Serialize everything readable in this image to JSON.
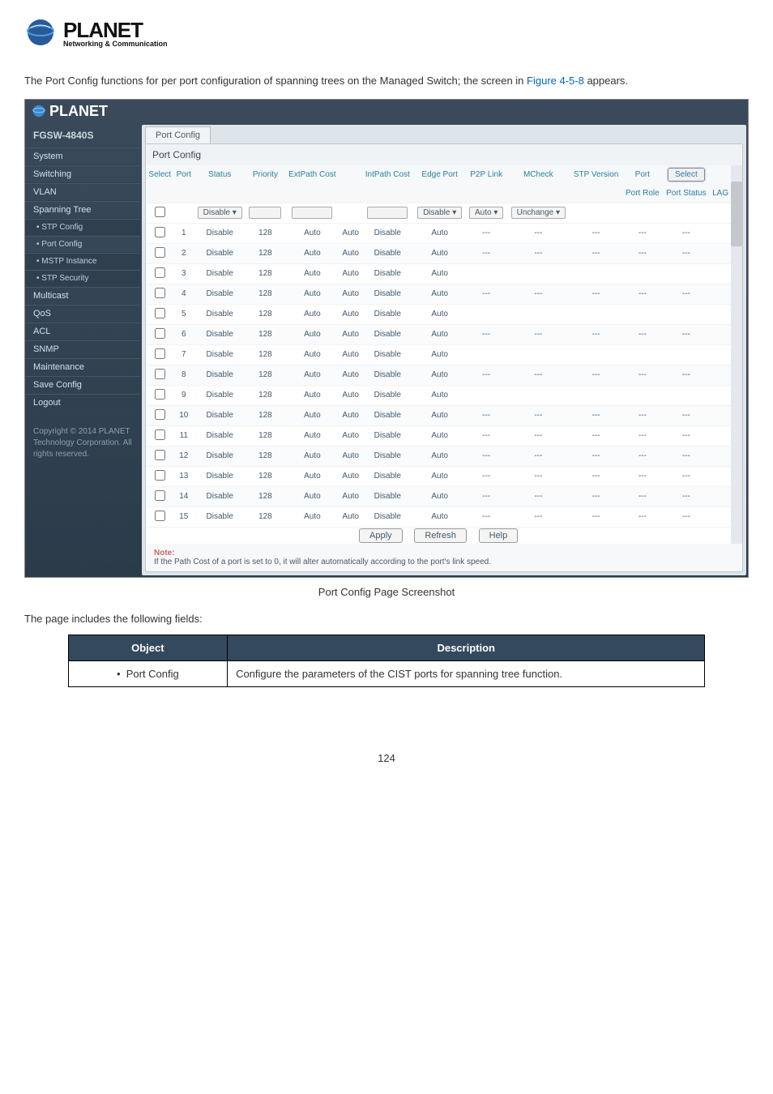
{
  "logo": {
    "brand": "PLANET",
    "tagline": "Networking & Communication"
  },
  "intro": {
    "text_before": "The Port Config functions for per port configuration of spanning trees on the Managed Switch; the screen in ",
    "figure_link": "Figure 4-5-8",
    "text_after": " appears."
  },
  "screenshot": {
    "brand": "PLANET",
    "model": "FGSW-4840S",
    "sidebar": {
      "items": [
        {
          "label": "System"
        },
        {
          "label": "Switching"
        },
        {
          "label": "VLAN"
        },
        {
          "label": "Spanning Tree"
        },
        {
          "label": "• STP Config",
          "sub": true
        },
        {
          "label": "• Port Config",
          "sub": true,
          "active": true
        },
        {
          "label": "• MSTP Instance",
          "sub": true
        },
        {
          "label": "• STP Security",
          "sub": true
        },
        {
          "label": "Multicast"
        },
        {
          "label": "QoS"
        },
        {
          "label": "ACL"
        },
        {
          "label": "SNMP"
        },
        {
          "label": "Maintenance"
        },
        {
          "label": "Save Config"
        },
        {
          "label": "Logout"
        }
      ],
      "copyright": "Copyright © 2014 PLANET Technology Corporation. All rights reserved."
    },
    "tab": "Port Config",
    "panel_title": "Port Config",
    "columns": {
      "select": "Select",
      "port": "Port",
      "status": "Status",
      "priority": "Priority",
      "ext": "ExtPath Cost",
      "intauto": "",
      "intcost": "IntPath Cost",
      "edge": "Edge Port",
      "p2p": "P2P Link",
      "mcheck": "MCheck",
      "stpv": "STP Version",
      "role": "Port Role",
      "pstatus": "Port Status",
      "lag": "LAG",
      "portlabel": "Port",
      "selectbtn": "Select"
    },
    "filter_row": {
      "status": "Disable ▾",
      "edge": "Disable ▾",
      "p2p": "Auto    ▾",
      "mcheck": "Unchange ▾"
    },
    "rows": [
      {
        "port": "1",
        "status": "Disable",
        "priority": "128",
        "ext": "Auto",
        "intauto": "Auto",
        "intcost": "Disable",
        "edge": "Auto",
        "p2p": "---",
        "mcheck": "---",
        "stpv": "---",
        "role": "---",
        "pstatus": "---"
      },
      {
        "port": "2",
        "status": "Disable",
        "priority": "128",
        "ext": "Auto",
        "intauto": "Auto",
        "intcost": "Disable",
        "edge": "Auto",
        "p2p": "---",
        "mcheck": "---",
        "stpv": "---",
        "role": "---",
        "pstatus": "---"
      },
      {
        "port": "3",
        "status": "Disable",
        "priority": "128",
        "ext": "Auto",
        "intauto": "Auto",
        "intcost": "Disable",
        "edge": "Auto",
        "p2p": "",
        "mcheck": "",
        "stpv": "",
        "role": "",
        "pstatus": ""
      },
      {
        "port": "4",
        "status": "Disable",
        "priority": "128",
        "ext": "Auto",
        "intauto": "Auto",
        "intcost": "Disable",
        "edge": "Auto",
        "p2p": "---",
        "mcheck": "---",
        "stpv": "---",
        "role": "---",
        "pstatus": "---"
      },
      {
        "port": "5",
        "status": "Disable",
        "priority": "128",
        "ext": "Auto",
        "intauto": "Auto",
        "intcost": "Disable",
        "edge": "Auto",
        "p2p": "",
        "mcheck": "",
        "stpv": "",
        "role": "",
        "pstatus": ""
      },
      {
        "port": "6",
        "status": "Disable",
        "priority": "128",
        "ext": "Auto",
        "intauto": "Auto",
        "intcost": "Disable",
        "edge": "Auto",
        "p2p": "---",
        "mcheck": "---",
        "stpv": "---",
        "role": "---",
        "pstatus": "---"
      },
      {
        "port": "7",
        "status": "Disable",
        "priority": "128",
        "ext": "Auto",
        "intauto": "Auto",
        "intcost": "Disable",
        "edge": "Auto",
        "p2p": "",
        "mcheck": "",
        "stpv": "",
        "role": "",
        "pstatus": ""
      },
      {
        "port": "8",
        "status": "Disable",
        "priority": "128",
        "ext": "Auto",
        "intauto": "Auto",
        "intcost": "Disable",
        "edge": "Auto",
        "p2p": "---",
        "mcheck": "---",
        "stpv": "---",
        "role": "---",
        "pstatus": "---"
      },
      {
        "port": "9",
        "status": "Disable",
        "priority": "128",
        "ext": "Auto",
        "intauto": "Auto",
        "intcost": "Disable",
        "edge": "Auto",
        "p2p": "",
        "mcheck": "",
        "stpv": "",
        "role": "",
        "pstatus": ""
      },
      {
        "port": "10",
        "status": "Disable",
        "priority": "128",
        "ext": "Auto",
        "intauto": "Auto",
        "intcost": "Disable",
        "edge": "Auto",
        "p2p": "---",
        "mcheck": "---",
        "stpv": "---",
        "role": "---",
        "pstatus": "---"
      },
      {
        "port": "11",
        "status": "Disable",
        "priority": "128",
        "ext": "Auto",
        "intauto": "Auto",
        "intcost": "Disable",
        "edge": "Auto",
        "p2p": "---",
        "mcheck": "---",
        "stpv": "---",
        "role": "---",
        "pstatus": "---"
      },
      {
        "port": "12",
        "status": "Disable",
        "priority": "128",
        "ext": "Auto",
        "intauto": "Auto",
        "intcost": "Disable",
        "edge": "Auto",
        "p2p": "---",
        "mcheck": "---",
        "stpv": "---",
        "role": "---",
        "pstatus": "---"
      },
      {
        "port": "13",
        "status": "Disable",
        "priority": "128",
        "ext": "Auto",
        "intauto": "Auto",
        "intcost": "Disable",
        "edge": "Auto",
        "p2p": "---",
        "mcheck": "---",
        "stpv": "---",
        "role": "---",
        "pstatus": "---"
      },
      {
        "port": "14",
        "status": "Disable",
        "priority": "128",
        "ext": "Auto",
        "intauto": "Auto",
        "intcost": "Disable",
        "edge": "Auto",
        "p2p": "---",
        "mcheck": "---",
        "stpv": "---",
        "role": "---",
        "pstatus": "---"
      },
      {
        "port": "15",
        "status": "Disable",
        "priority": "128",
        "ext": "Auto",
        "intauto": "Auto",
        "intcost": "Disable",
        "edge": "Auto",
        "p2p": "---",
        "mcheck": "---",
        "stpv": "---",
        "role": "---",
        "pstatus": "---"
      }
    ],
    "buttons": {
      "apply": "Apply",
      "refresh": "Refresh",
      "help": "Help"
    },
    "note": {
      "label": "Note:",
      "text": "If the Path Cost of a port is set to 0, it will alter automatically according to the port's link speed."
    }
  },
  "caption": "Port Config Page Screenshot",
  "fields_intro": "The page includes the following fields:",
  "fields_table": {
    "header_obj": "Object",
    "header_desc": "Description",
    "row1_obj": "Port Config",
    "row1_desc": "Configure the parameters of the CIST ports for spanning tree function."
  },
  "page_number": "124"
}
